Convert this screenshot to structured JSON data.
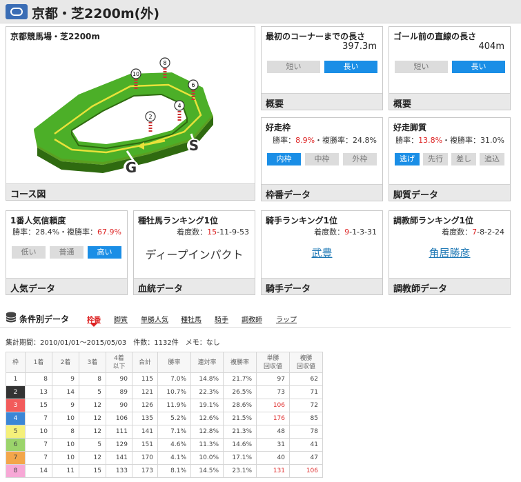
{
  "header": {
    "title": "京都・芝2200m(外)"
  },
  "course": {
    "heading": "京都競馬場・芝2200m",
    "footer": "コース図",
    "markers": [
      "10",
      "8",
      "6",
      "4",
      "2"
    ],
    "start_label": "S",
    "goal_label": "G"
  },
  "first_corner": {
    "heading": "最初のコーナーまでの長さ",
    "value": "397.3m",
    "buttons": [
      "短い",
      "長い"
    ],
    "active": 1,
    "footer": "概要"
  },
  "final_straight": {
    "heading": "ゴール前の直線の長さ",
    "value": "404m",
    "buttons": [
      "短い",
      "長い"
    ],
    "active": 1,
    "footer": "概要"
  },
  "good_gate": {
    "heading": "好走枠",
    "stat_prefix": "勝率：",
    "win": "8.9%",
    "stat_mid": "・複勝率：",
    "place": "24.8%",
    "buttons": [
      "内枠",
      "中枠",
      "外枠"
    ],
    "active": 0,
    "footer": "枠番データ"
  },
  "good_style": {
    "heading": "好走脚質",
    "stat_prefix": "勝率：",
    "win": "13.8%",
    "stat_mid": "・複勝率：",
    "place": "31.0%",
    "buttons": [
      "逃げ",
      "先行",
      "差し",
      "追込"
    ],
    "active": 0,
    "footer": "脚質データ"
  },
  "favorite": {
    "heading": "1番人気信頼度",
    "stat_prefix": "勝率：",
    "win": "28.4%",
    "stat_mid": "・複勝率：",
    "place": "67.9%",
    "buttons": [
      "低い",
      "普通",
      "高い"
    ],
    "active": 2,
    "footer": "人気データ"
  },
  "sire": {
    "heading": "種牡馬ランキング1位",
    "record_prefix": "着度数：",
    "first": "15",
    "rest": "-11-9-53",
    "name": "ディープインパクト",
    "footer": "血統データ"
  },
  "jockey": {
    "heading": "騎手ランキング1位",
    "record_prefix": "着度数：",
    "first": "9",
    "rest": "-1-3-31",
    "name": "武豊",
    "footer": "騎手データ"
  },
  "trainer": {
    "heading": "調教師ランキング1位",
    "record_prefix": "着度数：",
    "first": "7",
    "rest": "-8-2-24",
    "name": "角居勝彦",
    "footer": "調教師データ"
  },
  "conditions": {
    "label": "条件別データ",
    "tabs": [
      "枠番",
      "脚質",
      "単勝人気",
      "種牡馬",
      "騎手",
      "調教師",
      "ラップ"
    ],
    "active_tab": 0,
    "period": "集計期間：2010/01/01～2015/05/03　件数：1132件　メモ：なし"
  },
  "table": {
    "headers": [
      "枠",
      "1着",
      "2着",
      "3着",
      "4着\n以下",
      "合計",
      "勝率",
      "連対率",
      "複勝率",
      "単勝\n回収値",
      "複勝\n回収値"
    ],
    "rows": [
      [
        "1",
        "8",
        "9",
        "8",
        "90",
        "115",
        "7.0%",
        "14.8%",
        "21.7%",
        "97",
        "62"
      ],
      [
        "2",
        "13",
        "14",
        "5",
        "89",
        "121",
        "10.7%",
        "22.3%",
        "26.5%",
        "73",
        "71"
      ],
      [
        "3",
        "15",
        "9",
        "12",
        "90",
        "126",
        "11.9%",
        "19.1%",
        "28.6%",
        "106",
        "72"
      ],
      [
        "4",
        "7",
        "10",
        "12",
        "106",
        "135",
        "5.2%",
        "12.6%",
        "21.5%",
        "176",
        "85"
      ],
      [
        "5",
        "10",
        "8",
        "12",
        "111",
        "141",
        "7.1%",
        "12.8%",
        "21.3%",
        "48",
        "78"
      ],
      [
        "6",
        "7",
        "10",
        "5",
        "129",
        "151",
        "4.6%",
        "11.3%",
        "14.6%",
        "31",
        "41"
      ],
      [
        "7",
        "7",
        "10",
        "12",
        "141",
        "170",
        "4.1%",
        "10.0%",
        "17.1%",
        "40",
        "47"
      ],
      [
        "8",
        "14",
        "11",
        "15",
        "133",
        "173",
        "8.1%",
        "14.5%",
        "23.1%",
        "131",
        "106"
      ]
    ],
    "waku_colors": [
      "#ffffff",
      "#333333",
      "#f25b5b",
      "#3b86d6",
      "#f5f07a",
      "#9bd46b",
      "#f3a64a",
      "#f7a8d6"
    ],
    "waku_text_colors": [
      "#444444",
      "#ffffff",
      "#ffffff",
      "#ffffff",
      "#444444",
      "#444444",
      "#444444",
      "#444444"
    ],
    "highlight_color": "#e03030"
  }
}
